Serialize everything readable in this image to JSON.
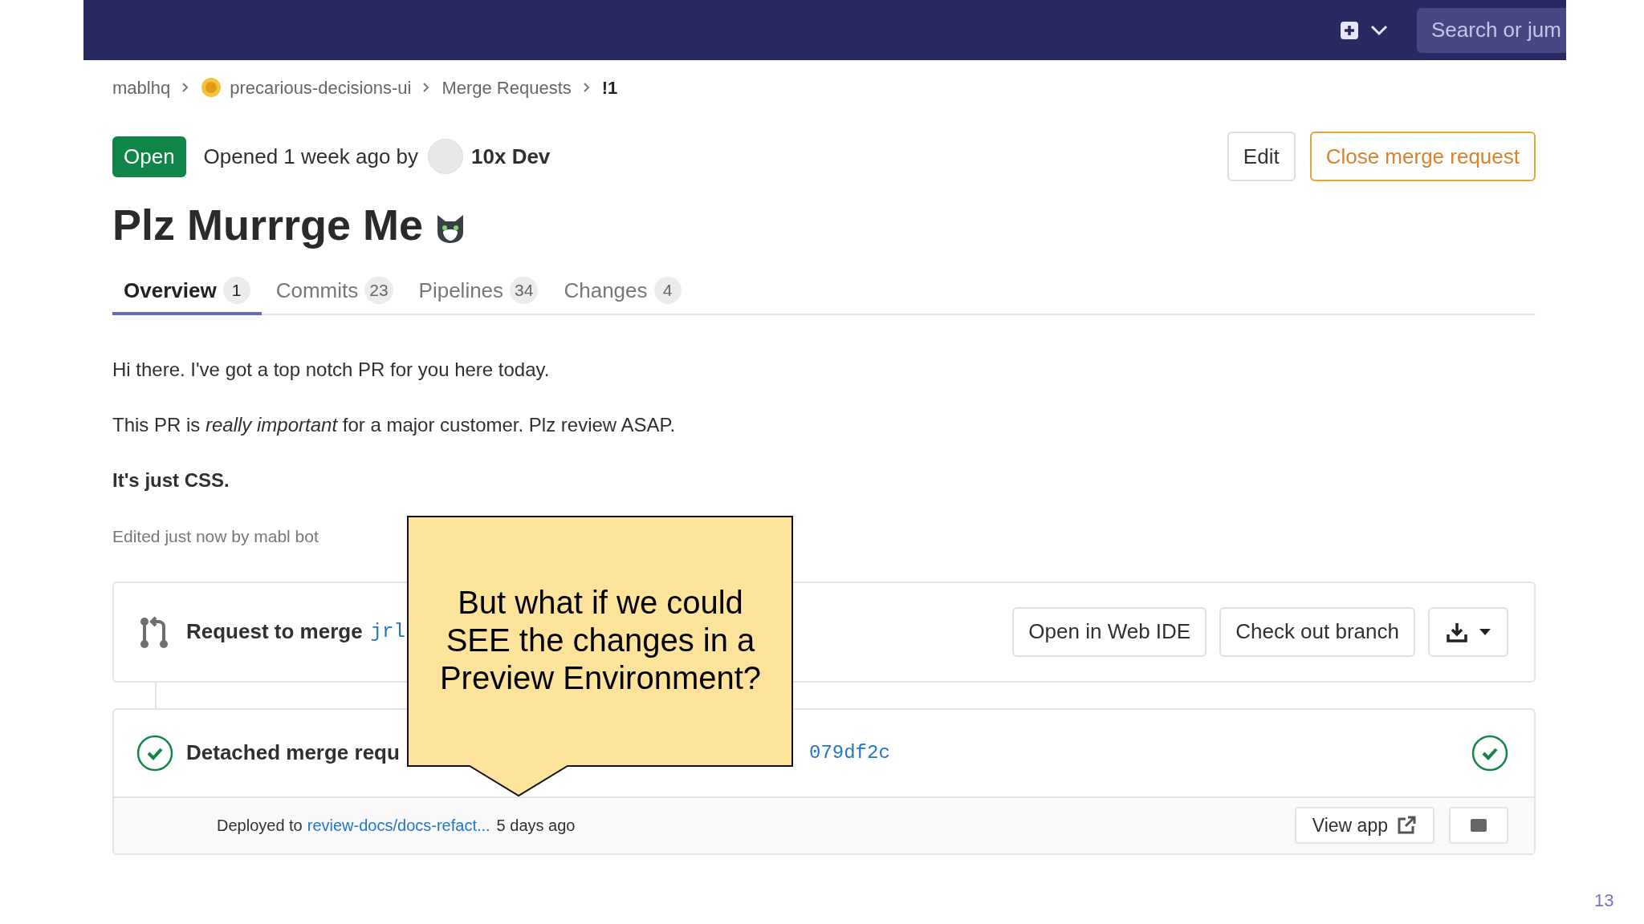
{
  "top_bar": {
    "search": {
      "placeholder": "Search or jum"
    }
  },
  "breadcrumbs": [
    {
      "label": "mablhq",
      "kind": "group"
    },
    {
      "label": "precarious-decisions-ui",
      "kind": "project"
    },
    {
      "label": "Merge Requests",
      "kind": "group"
    },
    {
      "label": "!1",
      "kind": "current"
    }
  ],
  "header": {
    "status": "Open",
    "opened_text": "Opened 1 week ago by",
    "author": "10x Dev",
    "buttons": [
      {
        "label": "Edit",
        "kind": "default"
      },
      {
        "label": "Close merge request",
        "kind": "warning"
      }
    ]
  },
  "title": "Plz Murrrge Me",
  "tabs": [
    {
      "label": "Overview",
      "count": "1",
      "selected": true
    },
    {
      "label": "Commits",
      "count": "23",
      "selected": false
    },
    {
      "label": "Pipelines",
      "count": "34",
      "selected": false
    },
    {
      "label": "Changes",
      "count": "4",
      "selected": false
    }
  ],
  "description": [
    {
      "text": "Hi there. I've got a top notch PR for you here today.",
      "bold": false
    },
    {
      "text": "This PR is *really important* for a major customer. Plz review ASAP.",
      "bold": false
    },
    {
      "text": "It's just CSS.",
      "bold": true
    }
  ],
  "edited_note": "Edited just now by mabl bot",
  "merge_card": {
    "label": "Request to merge",
    "branch": "jrl",
    "buttons": [
      "Open in Web IDE",
      "Check out branch"
    ]
  },
  "pipeline": {
    "text": "Detached merge requ",
    "commit": "079df2c"
  },
  "deployment": {
    "label": "Deployed to",
    "environment": "review-docs/docs-refact...",
    "time": "5 days ago",
    "button": "View app"
  },
  "callout": {
    "text": "But what if we could SEE the changes in a Preview Environment?"
  },
  "slide_number": "13"
}
